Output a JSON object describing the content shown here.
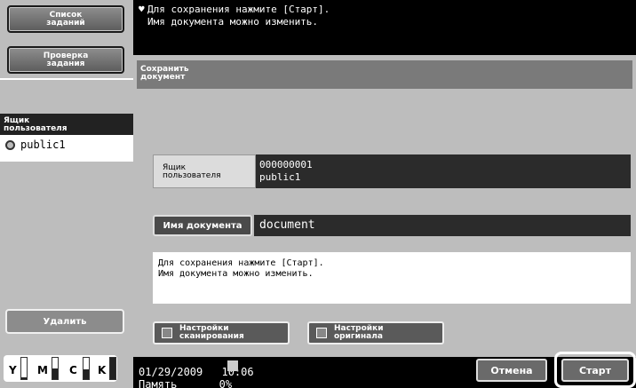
{
  "left_panel": {
    "job_list_button": "Список\nзаданий",
    "check_job_button": "Проверка\nзадания",
    "user_box_header": "Ящик\nпользователя",
    "user_box_item": "public1",
    "delete_button": "Удалить",
    "toner": [
      {
        "label": "Y",
        "level": 0.1
      },
      {
        "label": "M",
        "level": 0.5
      },
      {
        "label": "C",
        "level": 0.45
      },
      {
        "label": "K",
        "level": 1.0
      }
    ]
  },
  "top_message": {
    "icon": "info-icon",
    "line1": "Для сохранения нажмите [Старт].",
    "line2": "Имя документа можно изменить."
  },
  "main": {
    "title": "Сохранить\nдокумент",
    "user_box_label": "Ящик\nпользователя",
    "user_box_number": "000000001",
    "user_box_name": "public1",
    "doc_name_button": "Имя документа",
    "doc_name_value": "document",
    "message": "Для сохранения нажмите [Старт].\nИмя документа можно изменить.",
    "scan_settings_button": "Настройки\nсканирования",
    "original_settings_button": "Настройки\nоригинала"
  },
  "bottom": {
    "date": "01/29/2009",
    "time": "10:06",
    "memory_label": "Память",
    "memory_value": "0%",
    "cancel_button": "Отмена",
    "start_button": "Старт"
  }
}
